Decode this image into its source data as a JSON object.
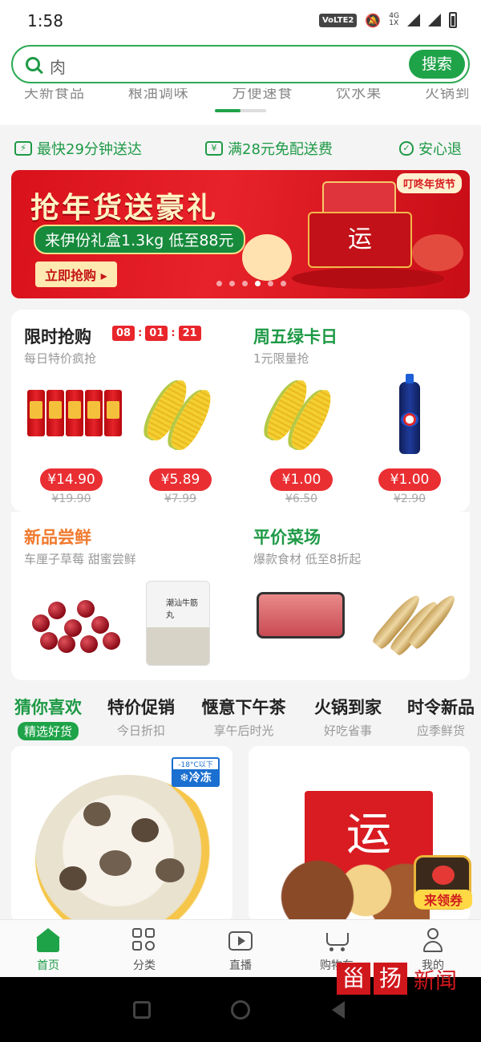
{
  "status_bar": {
    "time": "1:58",
    "network_badge": "VoLTE2",
    "signal_text": "4G\n1X"
  },
  "search": {
    "query": "肉",
    "button": "搜索"
  },
  "category_strip": {
    "items": [
      "天新食品",
      "粮油调味",
      "方便速食",
      "饮水果",
      "火锅到家"
    ]
  },
  "promises": [
    {
      "icon": "delivery-icon",
      "label": "最快29分钟送达"
    },
    {
      "icon": "yen-icon",
      "label": "满28元免配送费"
    },
    {
      "icon": "shield-check-icon",
      "label": "安心退"
    }
  ],
  "banner": {
    "title": "抢年货送豪礼",
    "subtitle": "来伊份礼盒1.3kg 低至88元",
    "cta": "立即抢购 ▸",
    "tag": "叮咚年货节",
    "box_char": "运",
    "dots": 6,
    "active_dot": 3
  },
  "flash_sale": {
    "title": "限时抢购",
    "timer": [
      "08",
      "01",
      "21"
    ],
    "subtitle": "每日特价疯抢",
    "products": [
      {
        "name": "herbal-tea-cans",
        "price": "¥14.90",
        "old_price": "¥19.90"
      },
      {
        "name": "corn",
        "price": "¥5.89",
        "old_price": "¥7.99"
      }
    ]
  },
  "green_card": {
    "title": "周五绿卡日",
    "subtitle": "1元限量抢",
    "products": [
      {
        "name": "corn",
        "price": "¥1.00",
        "old_price": "¥6.50"
      },
      {
        "name": "pepsi-bottle",
        "price": "¥1.00",
        "old_price": "¥2.90"
      }
    ]
  },
  "new_items": {
    "title": "新品尝鲜",
    "subtitle": "车厘子草莓 甜蜜尝鲜",
    "bag_label": "潮汕牛筋丸"
  },
  "veg_market": {
    "title": "平价菜场",
    "subtitle": "爆款食材  低至8折起"
  },
  "tabs": [
    {
      "label": "猜你喜欢",
      "sub": "精选好货"
    },
    {
      "label": "特价促销",
      "sub": "今日折扣"
    },
    {
      "label": "惬意下午茶",
      "sub": "享午后时光"
    },
    {
      "label": "火锅到家",
      "sub": "好吃省事"
    },
    {
      "label": "时令新品",
      "sub": "应季鲜货"
    }
  ],
  "feed": {
    "frozen_badge_top": "-18°C以下",
    "frozen_badge": "❄冷冻",
    "gift_char": "运",
    "coupon": "来领券"
  },
  "bottom_nav": [
    {
      "label": "首页",
      "icon": "home-icon"
    },
    {
      "label": "分类",
      "icon": "category-icon"
    },
    {
      "label": "直播",
      "icon": "live-icon"
    },
    {
      "label": "购物车",
      "icon": "cart-icon"
    },
    {
      "label": "我的",
      "icon": "profile-icon"
    }
  ],
  "watermark": {
    "box1": "甾",
    "box2": "扬",
    "text": "新闻"
  },
  "colors": {
    "brand_green": "#1fa349",
    "price_red": "#ea2f33",
    "banner_red": "#d8111a"
  }
}
